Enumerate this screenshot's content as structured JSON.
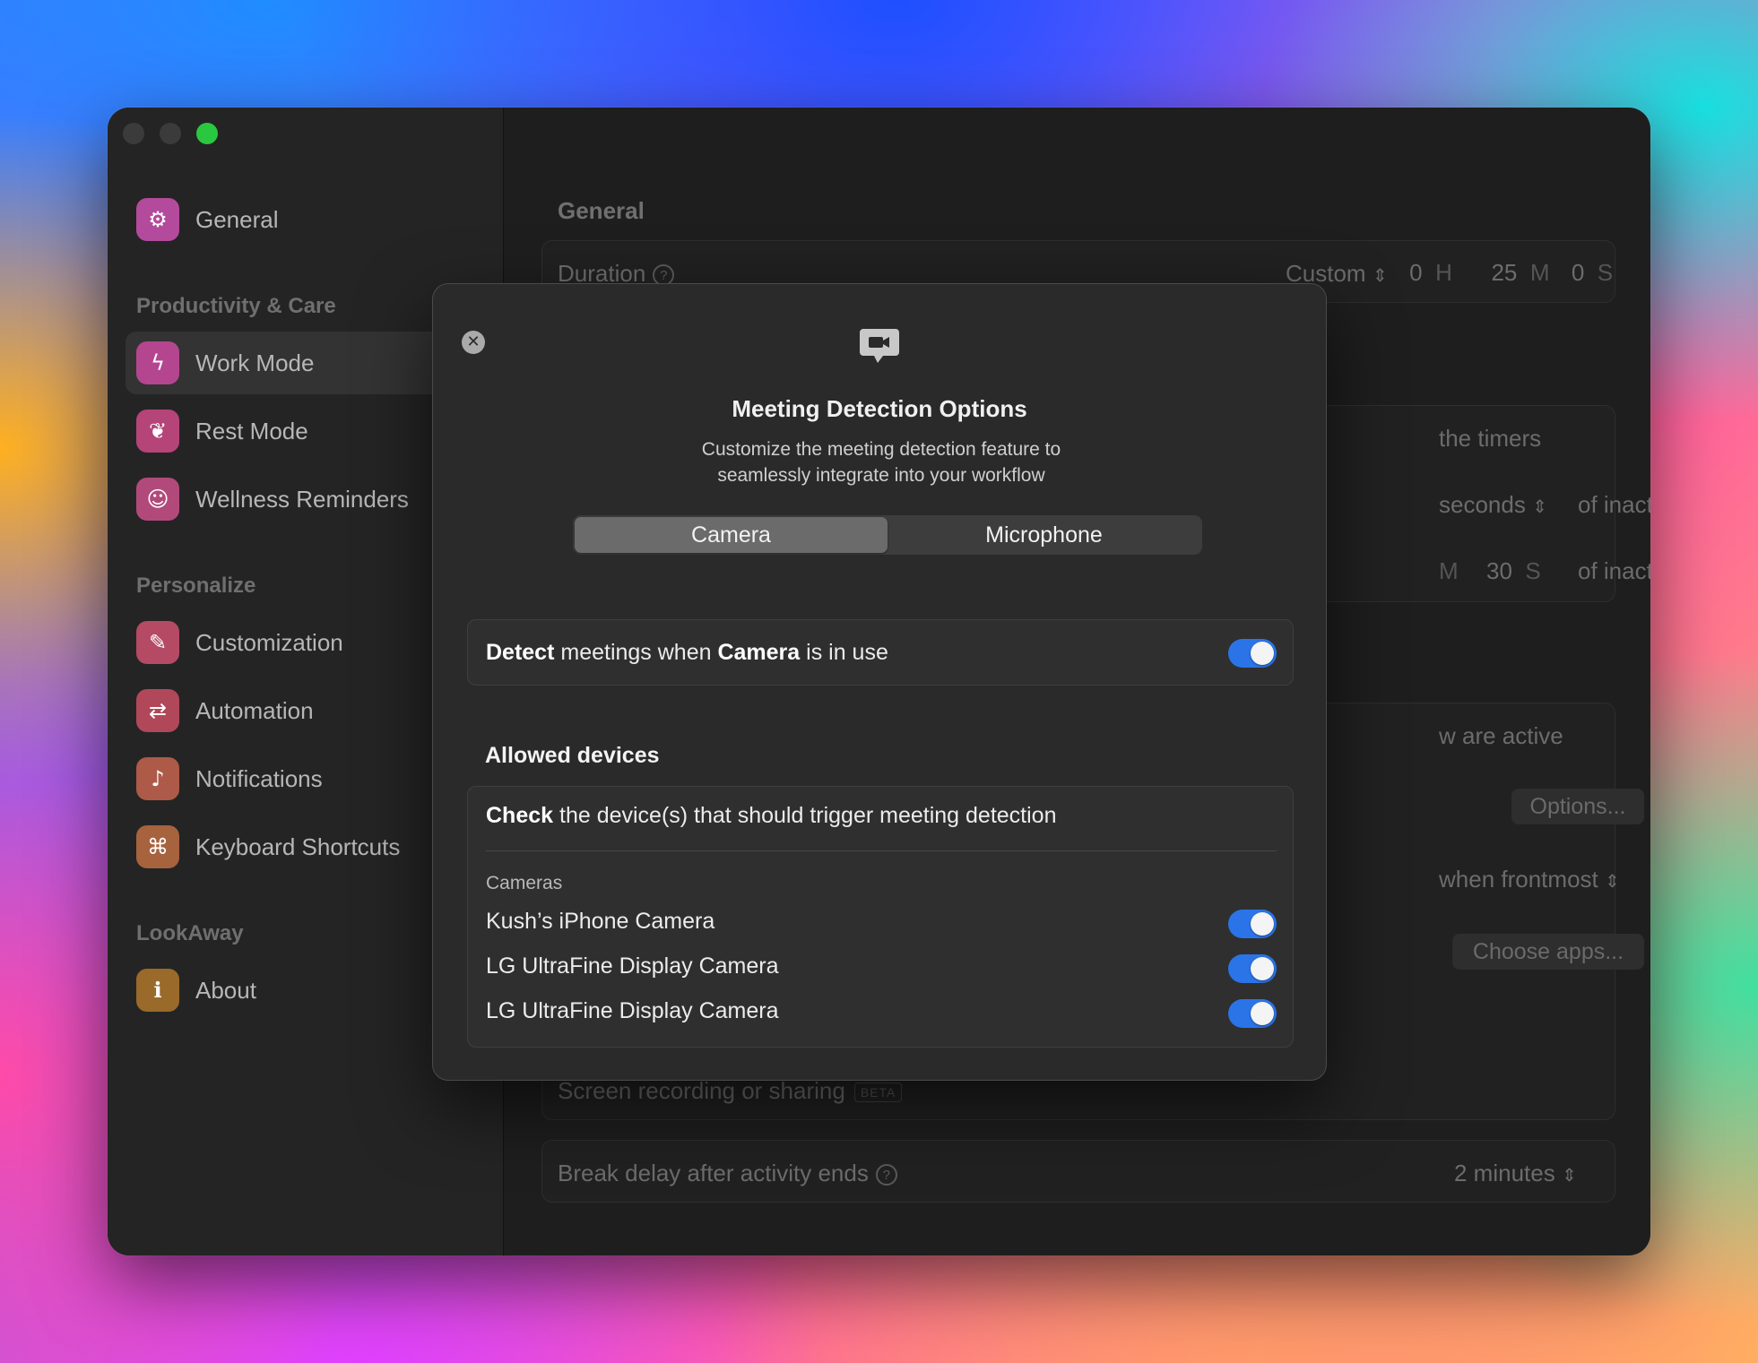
{
  "sidebar": {
    "general": {
      "label": "General",
      "color": "#b44a9c"
    },
    "sections": [
      {
        "heading": "Productivity & Care"
      },
      {
        "heading": "Personalize"
      },
      {
        "heading": "LookAway"
      }
    ],
    "items": [
      {
        "label": "Work Mode",
        "icon": "bolt-icon",
        "color": "#b4468f"
      },
      {
        "label": "Rest Mode",
        "icon": "leaf-icon",
        "color": "#b54478"
      },
      {
        "label": "Wellness Reminders",
        "icon": "figure-icon",
        "color": "#b14a7a"
      },
      {
        "label": "Customization",
        "icon": "brush-icon",
        "color": "#b44a64"
      },
      {
        "label": "Automation",
        "icon": "repeat-icon",
        "color": "#b0485a"
      },
      {
        "label": "Notifications",
        "icon": "bell-icon",
        "color": "#ad5a48"
      },
      {
        "label": "Keyboard Shortcuts",
        "icon": "command-icon",
        "color": "#a7623e"
      },
      {
        "label": "About",
        "icon": "info-icon",
        "color": "#9a6a2a"
      }
    ]
  },
  "background_panel": {
    "general_heading": "General",
    "duration_label": "Duration",
    "duration_preset": "Custom",
    "hours": "0",
    "hours_unit": "H",
    "minutes": "25",
    "minutes_unit": "M",
    "seconds": "0",
    "seconds_unit": "S",
    "timers_text": "the timers",
    "seconds_text": "seconds",
    "inactivity_1": "of inactivity",
    "m_unit": "M",
    "secs_value": "30",
    "s_unit": "S",
    "inactivity_2": "of inactivity",
    "active_text": "w are active",
    "options_button": "Options...",
    "frontmost_text": "when frontmost",
    "choose_apps_button": "Choose apps...",
    "screen_recording": "Screen recording or sharing",
    "beta_badge": "BETA",
    "break_delay_label": "Break delay after activity ends",
    "break_delay_value": "2 minutes"
  },
  "modal": {
    "title": "Meeting Detection Options",
    "subtitle": "Customize the meeting detection feature to seamlessly integrate into your workflow",
    "tabs": [
      {
        "label": "Camera",
        "selected": true
      },
      {
        "label": "Microphone",
        "selected": false
      }
    ],
    "detect": {
      "bold1": "Detect",
      "text1": " meetings when ",
      "bold2": "Camera",
      "text2": " is in use",
      "enabled": true
    },
    "allowed_heading": "Allowed devices",
    "check_bold": "Check",
    "check_text": " the device(s) that should trigger meeting detection",
    "cameras_heading": "Cameras",
    "devices": [
      {
        "name": "Kush’s iPhone Camera",
        "enabled": true
      },
      {
        "name": "LG UltraFine Display Camera",
        "enabled": true
      },
      {
        "name": "LG UltraFine Display Camera",
        "enabled": true
      }
    ]
  },
  "colors": {
    "accent": "#2a74e8",
    "window_green": "#2ac840"
  }
}
